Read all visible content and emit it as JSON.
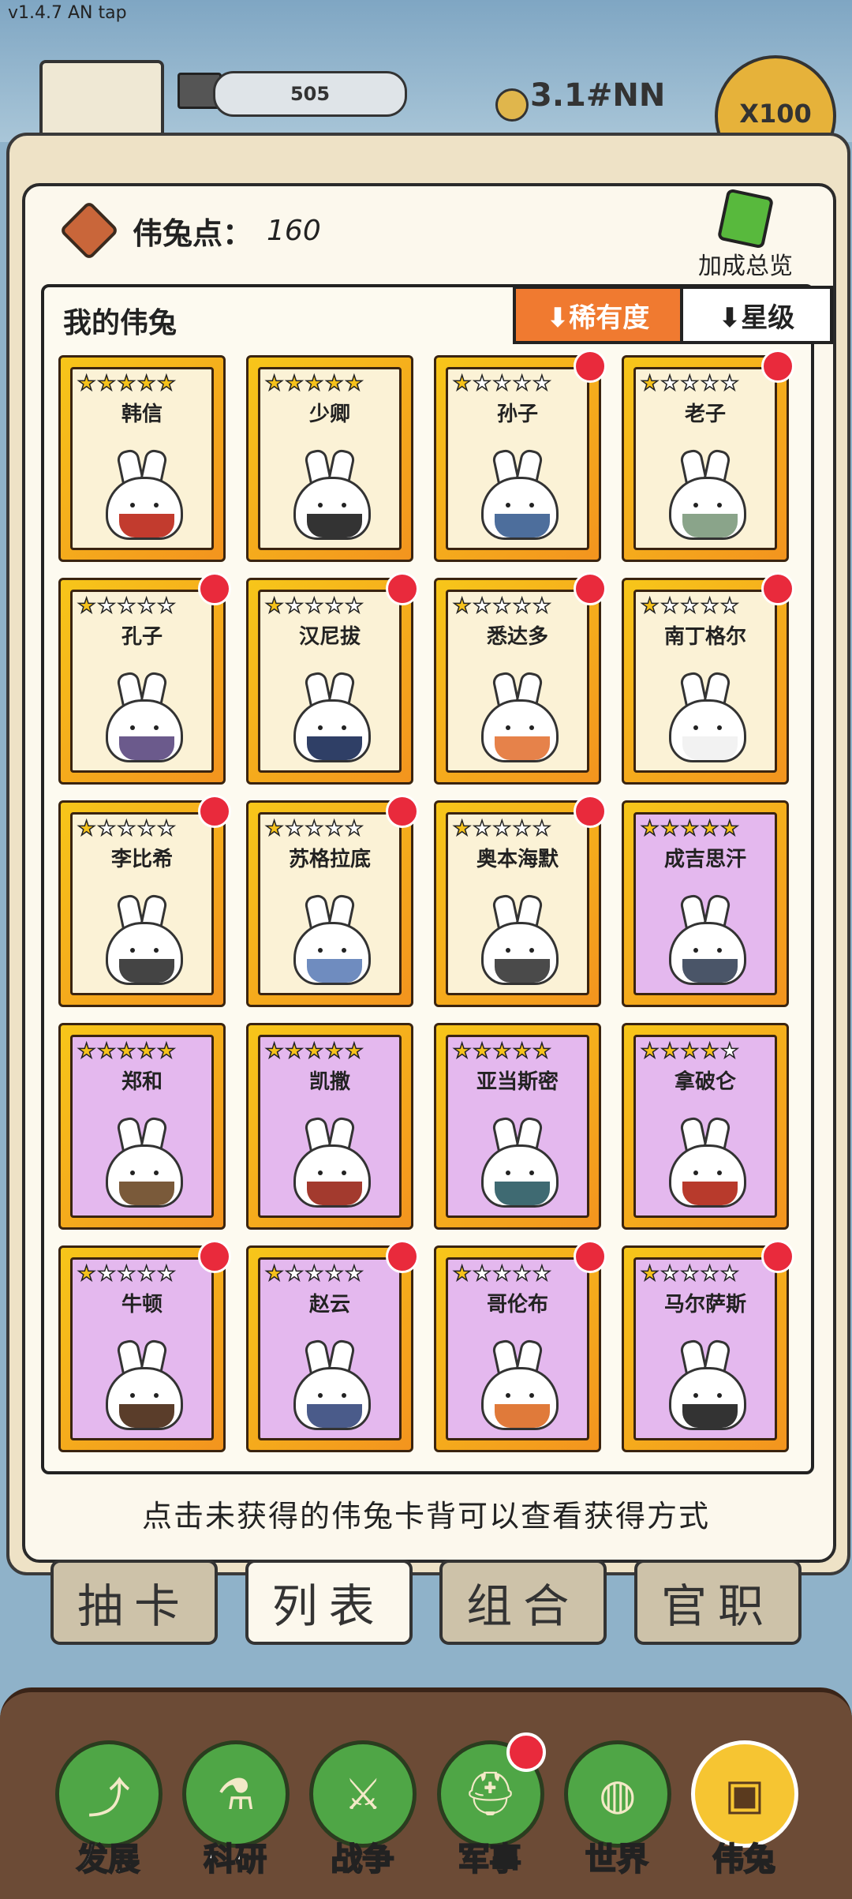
{
  "version": "v1.4.7 AN tap",
  "hud": {
    "bar_value": "505",
    "currency": "3.1#NN",
    "x100": "X100"
  },
  "points": {
    "label": "伟兔点：",
    "value": "160"
  },
  "bonus_label": "加成总览",
  "section_title": "我的伟兔",
  "sort": {
    "rarity": "⬇稀有度",
    "star": "⬇星级"
  },
  "cards": [
    {
      "name": "韩信",
      "stars": 5,
      "color": "gold",
      "badge": false,
      "robe": "#c23b2e"
    },
    {
      "name": "少卿",
      "stars": 5,
      "color": "gold",
      "badge": false,
      "robe": "#333333"
    },
    {
      "name": "孙子",
      "stars": 1,
      "color": "gold",
      "badge": true,
      "robe": "#4d6e9c"
    },
    {
      "name": "老子",
      "stars": 1,
      "color": "gold",
      "badge": true,
      "robe": "#8aa48a"
    },
    {
      "name": "孔子",
      "stars": 1,
      "color": "gold",
      "badge": true,
      "robe": "#6b5a8c"
    },
    {
      "name": "汉尼拔",
      "stars": 1,
      "color": "gold",
      "badge": true,
      "robe": "#2f3f66"
    },
    {
      "name": "悉达多",
      "stars": 1,
      "color": "gold",
      "badge": true,
      "robe": "#e6824a"
    },
    {
      "name": "南丁格尔",
      "stars": 1,
      "color": "gold",
      "badge": true,
      "robe": "#f2f2f2"
    },
    {
      "name": "李比希",
      "stars": 1,
      "color": "gold",
      "badge": true,
      "robe": "#444444"
    },
    {
      "name": "苏格拉底",
      "stars": 1,
      "color": "gold",
      "badge": true,
      "robe": "#6f8cbf"
    },
    {
      "name": "奥本海默",
      "stars": 1,
      "color": "gold",
      "badge": true,
      "robe": "#4a4a4a"
    },
    {
      "name": "成吉思汗",
      "stars": 5,
      "color": "purple",
      "badge": false,
      "robe": "#4a5568"
    },
    {
      "name": "郑和",
      "stars": 5,
      "color": "purple",
      "badge": false,
      "robe": "#7a5a3a"
    },
    {
      "name": "凯撒",
      "stars": 5,
      "color": "purple",
      "badge": false,
      "robe": "#a33a2e"
    },
    {
      "name": "亚当斯密",
      "stars": 5,
      "color": "purple",
      "badge": false,
      "robe": "#3f6a72"
    },
    {
      "name": "拿破仑",
      "stars": 4,
      "color": "purple",
      "badge": false,
      "robe": "#b83a2c"
    },
    {
      "name": "牛顿",
      "stars": 1,
      "color": "purple",
      "badge": true,
      "robe": "#5a3d2a"
    },
    {
      "name": "赵云",
      "stars": 1,
      "color": "purple",
      "badge": true,
      "robe": "#4a5b8a"
    },
    {
      "name": "哥伦布",
      "stars": 1,
      "color": "purple",
      "badge": true,
      "robe": "#e07a3a"
    },
    {
      "name": "马尔萨斯",
      "stars": 1,
      "color": "purple",
      "badge": true,
      "robe": "#333333"
    }
  ],
  "hint": "点击未获得的伟兔卡背可以查看获得方式",
  "tabs": [
    "抽卡",
    "列表",
    "组合",
    "官职"
  ],
  "active_tab": 1,
  "nav": [
    {
      "label": "发展",
      "icon": "⤴",
      "badge": false
    },
    {
      "label": "科研",
      "icon": "⚗",
      "badge": false
    },
    {
      "label": "战争",
      "icon": "⚔",
      "badge": false
    },
    {
      "label": "军事",
      "icon": "⛑",
      "badge": true
    },
    {
      "label": "世界",
      "icon": "◍",
      "badge": false
    },
    {
      "label": "伟兔",
      "icon": "▣",
      "badge": false
    }
  ],
  "active_nav": 5,
  "colors": {
    "gold_card": "#fbf2d6",
    "purple_card": "#e4b8ee",
    "badge": "#e92a3c",
    "accent": "#f07a30"
  }
}
